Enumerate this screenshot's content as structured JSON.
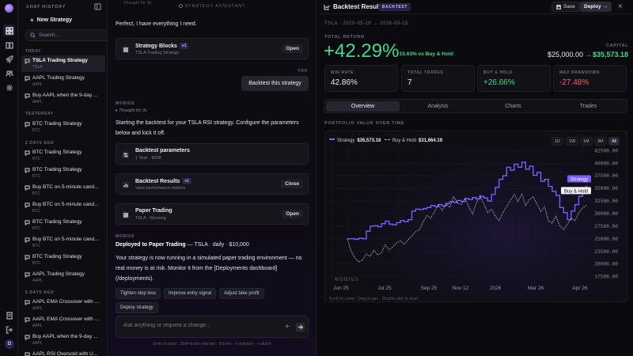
{
  "sidebar": {
    "title": "CHAT HISTORY",
    "new_chat": "New Strategy",
    "search_placeholder": "Search...",
    "groups": [
      {
        "label": "TODAY",
        "items": [
          {
            "title": "TSLA Trading Strategy",
            "sub": "TSLA",
            "active": true
          },
          {
            "title": "AAPL Trading Strategy",
            "sub": "AAPL"
          },
          {
            "title": "Buy AAPL when the 9-day ...",
            "sub": "AAPL"
          }
        ]
      },
      {
        "label": "YESTERDAY",
        "items": [
          {
            "title": "BTC Trading Strategy",
            "sub": "BTC"
          }
        ]
      },
      {
        "label": "2 DAYS AGO",
        "items": [
          {
            "title": "BTC Trading Strategy",
            "sub": "BTC"
          },
          {
            "title": "BTC Trading Strategy",
            "sub": "BTC"
          },
          {
            "title": "Buy BTC on 5-minute cand...",
            "sub": "BTC"
          },
          {
            "title": "Buy BTC on 5-minute cand...",
            "sub": "BTC"
          },
          {
            "title": "BTC Trading Strategy",
            "sub": "BTC"
          },
          {
            "title": "Buy BTC on 5-minute cand...",
            "sub": "BTC"
          },
          {
            "title": "BTC Trading Strategy",
            "sub": "BTC"
          },
          {
            "title": "AAPL Trading Strategy",
            "sub": "AAPL"
          }
        ]
      },
      {
        "label": "5 DAYS AGO",
        "items": [
          {
            "title": "AAPL EMA Crossover with ...",
            "sub": "AAPL"
          },
          {
            "title": "AAPL EMA Crossover with ...",
            "sub": "AAPL"
          },
          {
            "title": "Buy AAPL when the 9-day ...",
            "sub": "AAPL"
          },
          {
            "title": "AAPL RSI Oversold with U...",
            "sub": "AAPL"
          }
        ]
      }
    ],
    "avatar": "D"
  },
  "chat": {
    "header": "STRATEGY ASSISTANT",
    "top_fade": "Thought for 4s",
    "msg1": "Perfect, I have everything I need.",
    "card_blocks": {
      "title": "Strategy Blocks",
      "ver": "v1",
      "sub": "TSLA Trading Strategy",
      "btn": "Open"
    },
    "user_role": "YOU",
    "user_msg": "Backtest this strategy",
    "bot_role": "MOBIUS",
    "thought": "Thought for 3s",
    "msg2": "Starting the backtest for your TSLA RSI strategy. Configure the parameters below and kick it off.",
    "card_params": {
      "title": "Backtest parameters",
      "sub": "1 Year · $25K"
    },
    "card_results": {
      "title": "Backtest Results",
      "ver": "v1",
      "sub": "View performance metrics",
      "btn": "Close"
    },
    "card_paper": {
      "title": "Paper Trading",
      "sub": "TSLA · Running",
      "btn": "Open"
    },
    "bot_role2": "MOBIUS",
    "deployed_bold": "Deployed to Paper Trading",
    "deployed_rest": " — TSLA · daily · $10,000",
    "msg3": "Your strategy is now running in a simulated paper trading environment — no real money is at risk. Monitor it from the [Deployments dashboard](/deployments).",
    "chips": [
      "Tighten stop loss",
      "Improve entry signal",
      "Adjust take profit",
      "Deploy strategy"
    ],
    "composer_placeholder": "Ask anything or request a change...",
    "hint": "Enter to send · Shift+Enter new line · $ ticker · # indicator · + attach"
  },
  "pane": {
    "title": "Backtest Results",
    "badge": "BACKTEST",
    "save": "Save",
    "deploy": "Deploy →",
    "range": "TSLA · 2025-05-16 → 2026-05-15",
    "total_return_label": "TOTAL RETURN",
    "total_return": "+42.29%",
    "vs": "+15.63% vs Buy & Hold",
    "capital_label": "CAPITAL",
    "capital_start": "$25,000.00",
    "capital_arrow": "→",
    "capital_end": "$35,573.18",
    "stats": [
      {
        "label": "WIN RATE",
        "value": "42.86%",
        "tone": ""
      },
      {
        "label": "TOTAL TRADES",
        "value": "7",
        "tone": ""
      },
      {
        "label": "BUY & HOLD",
        "value": "+26.66%",
        "tone": "pos"
      },
      {
        "label": "MAX DRAWDOWN",
        "value": "-27.48%",
        "tone": "neg"
      }
    ],
    "tabs": [
      "Overview",
      "Analysis",
      "Charts",
      "Trades"
    ],
    "portfolio_label": "PORTFOLIO VALUE OVER TIME",
    "ranges": [
      "1D",
      "1W",
      "1M",
      "3M",
      "All"
    ],
    "legend_strategy": "Strategy",
    "legend_strategy_val": "$35,573.18",
    "legend_bh": "Buy & Hold",
    "legend_bh_val": "$31,664.19",
    "watermark": "MOBIUS",
    "chart_hint": "Scroll to zoom · Drag to pan · Double-click to reset"
  },
  "chart_data": {
    "type": "line",
    "title": "PORTFOLIO VALUE OVER TIME",
    "x_ticks": [
      "Jun 25",
      "Jul 25",
      "Sep 25",
      "Nov 12",
      "2026",
      "Mar 26",
      "Apr 26"
    ],
    "y_ticks": [
      17500,
      20000,
      22500,
      25000,
      27500,
      30000,
      32500,
      35000,
      37500,
      40000,
      42500
    ],
    "ylim": [
      16500,
      43500
    ],
    "series": [
      {
        "name": "Strategy",
        "color": "#7b5cff",
        "end_label": "Strategy",
        "values": [
          25000,
          25000,
          24900,
          25100,
          25000,
          26500,
          27500,
          27600,
          27400,
          28000,
          28500,
          27900,
          27800,
          28200,
          28600,
          28400,
          28800,
          30500,
          30900,
          30800,
          31000,
          31200,
          31600,
          31400,
          31800,
          31500,
          32000,
          32400,
          32200,
          32600,
          32400,
          33000,
          32800,
          33200,
          32900,
          33400,
          33100,
          32500,
          33800,
          35200,
          36800,
          37500,
          39200,
          38600,
          39800,
          39200,
          40200,
          38800,
          39400,
          37600,
          38200,
          36400,
          36800,
          35400,
          34400,
          33600,
          31200,
          30200,
          28800,
          30500,
          31800,
          33400,
          34600,
          35573
        ]
      },
      {
        "name": "Buy & Hold",
        "color": "#bdbdc8",
        "dashed": true,
        "end_label": "Buy & Hold",
        "values": [
          25000,
          22500,
          21200,
          20400,
          20800,
          22000,
          21500,
          22700,
          21800,
          22300,
          23800,
          22800,
          23400,
          24200,
          24600,
          23900,
          24800,
          25600,
          26400,
          26800,
          28400,
          29600,
          29100,
          30400,
          31800,
          30600,
          32000,
          31200,
          33400,
          32100,
          31800,
          33000,
          31400,
          29900,
          32100,
          33600,
          31800,
          30200,
          30900,
          29500,
          28600,
          30200,
          31400,
          32600,
          33800,
          32400,
          33900,
          31600,
          32800,
          33400,
          31900,
          30400,
          31400,
          28600,
          28100,
          29500,
          27600,
          26800,
          27900,
          29100,
          28600,
          30200,
          31100,
          31664
        ]
      }
    ]
  }
}
